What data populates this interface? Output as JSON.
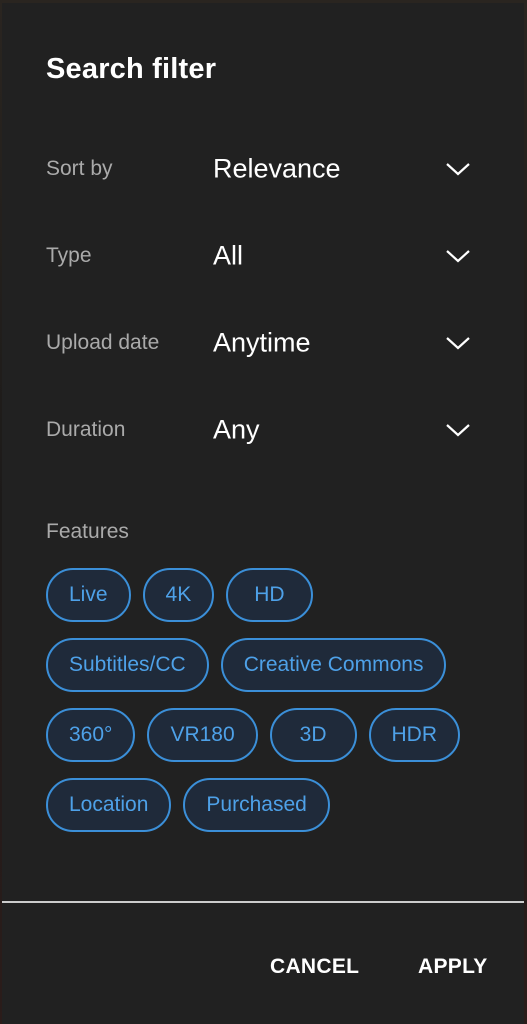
{
  "dialog": {
    "title": "Search filter"
  },
  "filters": [
    {
      "label": "Sort by",
      "value": "Relevance",
      "icon": "chevron-down-icon"
    },
    {
      "label": "Type",
      "value": "All",
      "icon": "chevron-down-icon"
    },
    {
      "label": "Upload date",
      "value": "Anytime",
      "icon": "chevron-down-icon"
    },
    {
      "label": "Duration",
      "value": "Any",
      "icon": "chevron-down-icon"
    }
  ],
  "features": {
    "label": "Features",
    "chips": [
      [
        "Live",
        "4K",
        "HD"
      ],
      [
        "Subtitles/CC",
        "Creative Commons"
      ],
      [
        "360°",
        "VR180",
        "3D",
        "HDR"
      ],
      [
        "Location",
        "Purchased"
      ]
    ]
  },
  "actions": {
    "cancel_label": "CANCEL",
    "apply_label": "APPLY"
  },
  "colors": {
    "dialog_bg": "#212121",
    "chip_border": "#3b8fd8",
    "chip_text": "#4ea1e8",
    "chip_bg": "#1f2a3a",
    "label_text": "#aaaaaa"
  }
}
